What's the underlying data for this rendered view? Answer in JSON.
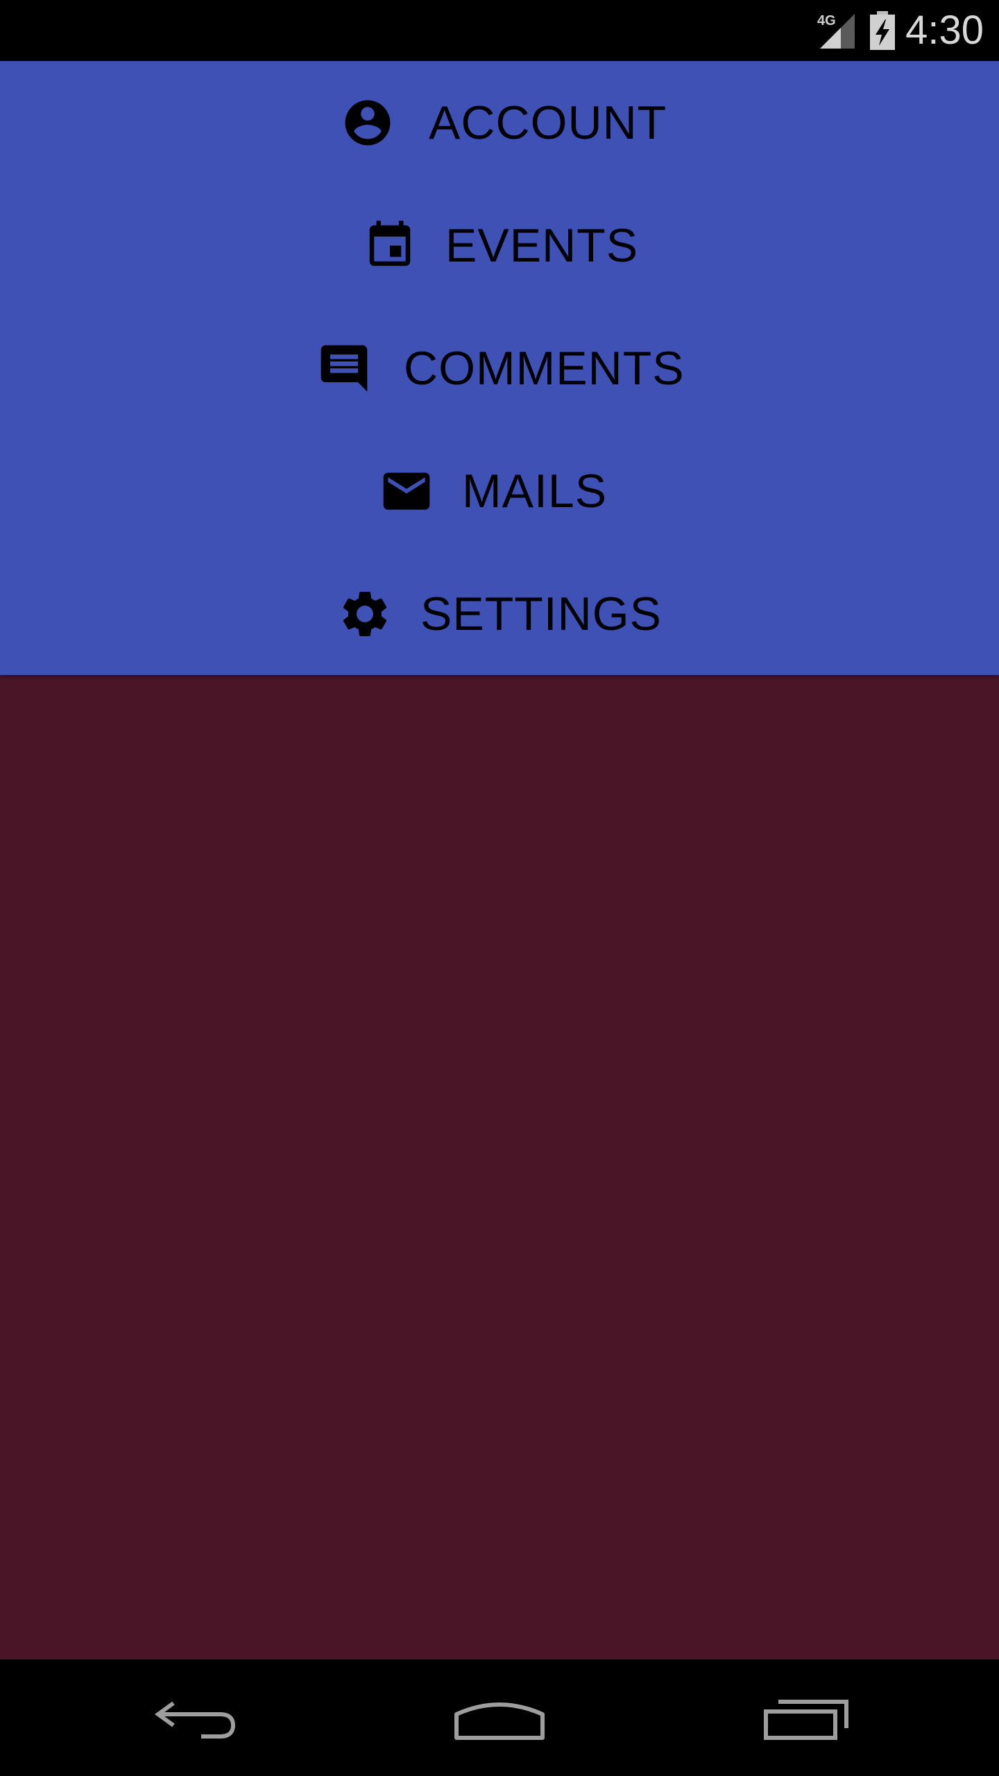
{
  "status_bar": {
    "network_label": "4G",
    "time": "4:30",
    "network_icon": "signal-4g-icon",
    "battery_icon": "battery-charging-icon"
  },
  "menu": {
    "background_color": "#3f51b5",
    "items": [
      {
        "label": "ACCOUNT",
        "icon": "account-circle-icon"
      },
      {
        "label": "EVENTS",
        "icon": "calendar-event-icon"
      },
      {
        "label": "COMMENTS",
        "icon": "comment-icon"
      },
      {
        "label": "MAILS",
        "icon": "mail-icon"
      },
      {
        "label": "SETTINGS",
        "icon": "gear-icon"
      }
    ]
  },
  "content": {
    "background_color": "#4a1527"
  },
  "nav_bar": {
    "back_icon": "back-icon",
    "home_icon": "home-icon",
    "recents_icon": "recent-apps-icon"
  }
}
